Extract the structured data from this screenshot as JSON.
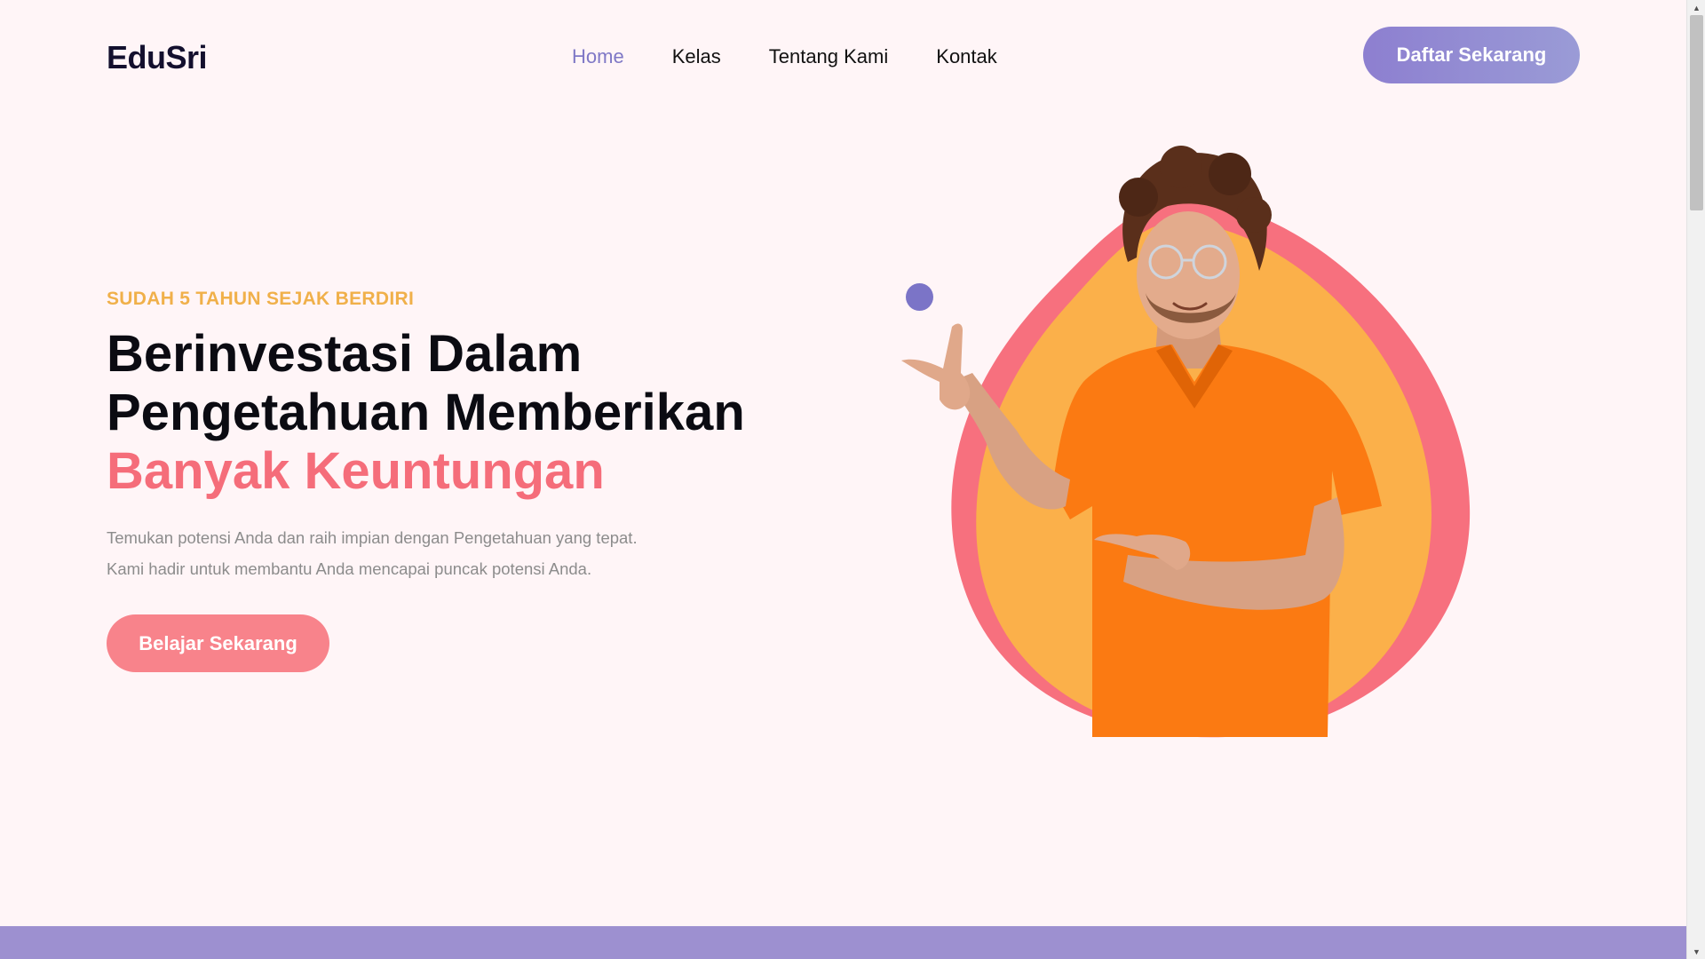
{
  "header": {
    "logo": "EduSri",
    "nav": [
      {
        "label": "Home",
        "active": true
      },
      {
        "label": "Kelas",
        "active": false
      },
      {
        "label": "Tentang Kami",
        "active": false
      },
      {
        "label": "Kontak",
        "active": false
      }
    ],
    "cta_label": "Daftar Sekarang"
  },
  "hero": {
    "eyebrow": "SUDAH 5 TAHUN SEJAK BERDIRI",
    "headline_line1": "Berinvestasi Dalam",
    "headline_line2": "Pengetahuan Memberikan",
    "headline_accent": "Banyak Keuntungan",
    "sub_line1": "Temukan potensi Anda dan raih impian dengan Pengetahuan yang tepat.",
    "sub_line2": "Kami hadir untuk membantu Anda mencapai puncak potensi Anda.",
    "cta_label": "Belajar Sekarang",
    "image": "person-pointing-illustration"
  },
  "colors": {
    "background": "#fff5f7",
    "nav_active": "#7f78c6",
    "eyebrow": "#f0b04a",
    "accent_pink": "#f56d7a",
    "cta_purple": "#8d7fd0",
    "cta_pink": "#f8838b",
    "blob_orange": "#fbb04a",
    "blob_pink": "#f7707e",
    "band": "#9d90d0"
  },
  "icons": {
    "scroll_up": "chevron-up-icon",
    "scroll_down": "chevron-down-icon"
  }
}
